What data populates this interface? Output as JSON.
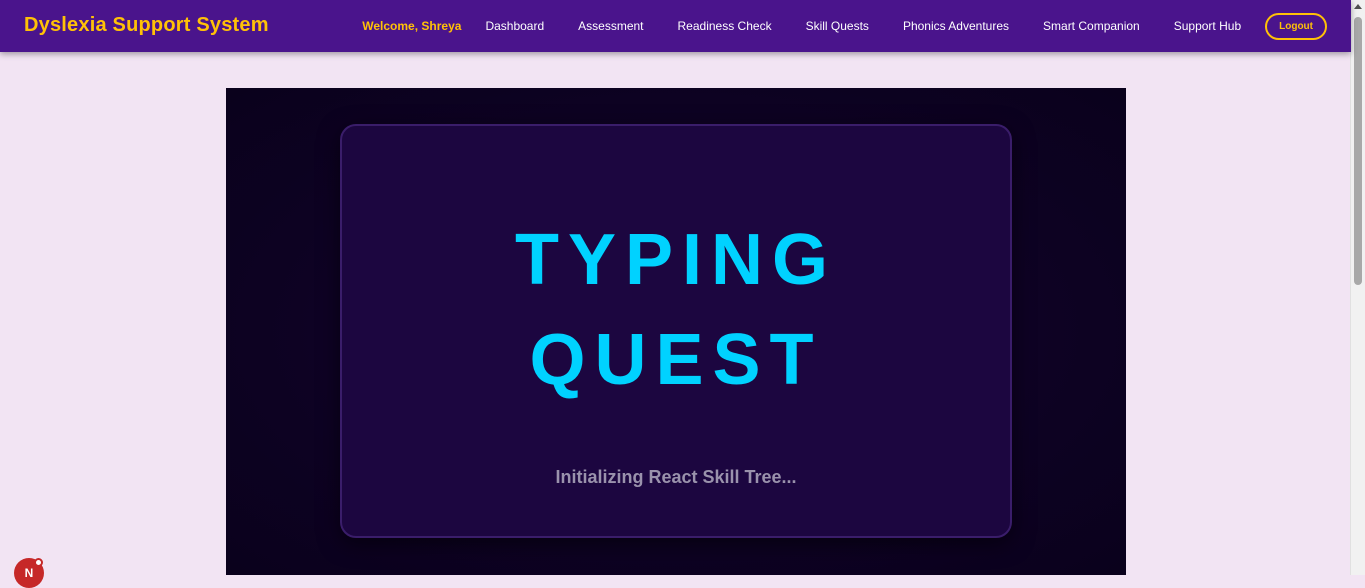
{
  "header": {
    "brand": "Dyslexia Support System",
    "welcome": "Welcome, Shreya",
    "nav": [
      {
        "label": "Dashboard"
      },
      {
        "label": "Assessment"
      },
      {
        "label": "Readiness Check"
      },
      {
        "label": "Skill Quests"
      },
      {
        "label": "Phonics Adventures"
      },
      {
        "label": "Smart Companion"
      },
      {
        "label": "Support Hub"
      }
    ],
    "logout_label": "Logout"
  },
  "loader": {
    "title_line1": "TYPING",
    "title_line2": "QUEST",
    "status": "Initializing React Skill Tree..."
  },
  "badge": {
    "letter": "N"
  },
  "colors": {
    "nav_bg": "#4a148c",
    "accent": "#ffc107",
    "page_bg": "#f2e4f3",
    "title": "#00d2ff",
    "card_bg": "#1c0640"
  }
}
